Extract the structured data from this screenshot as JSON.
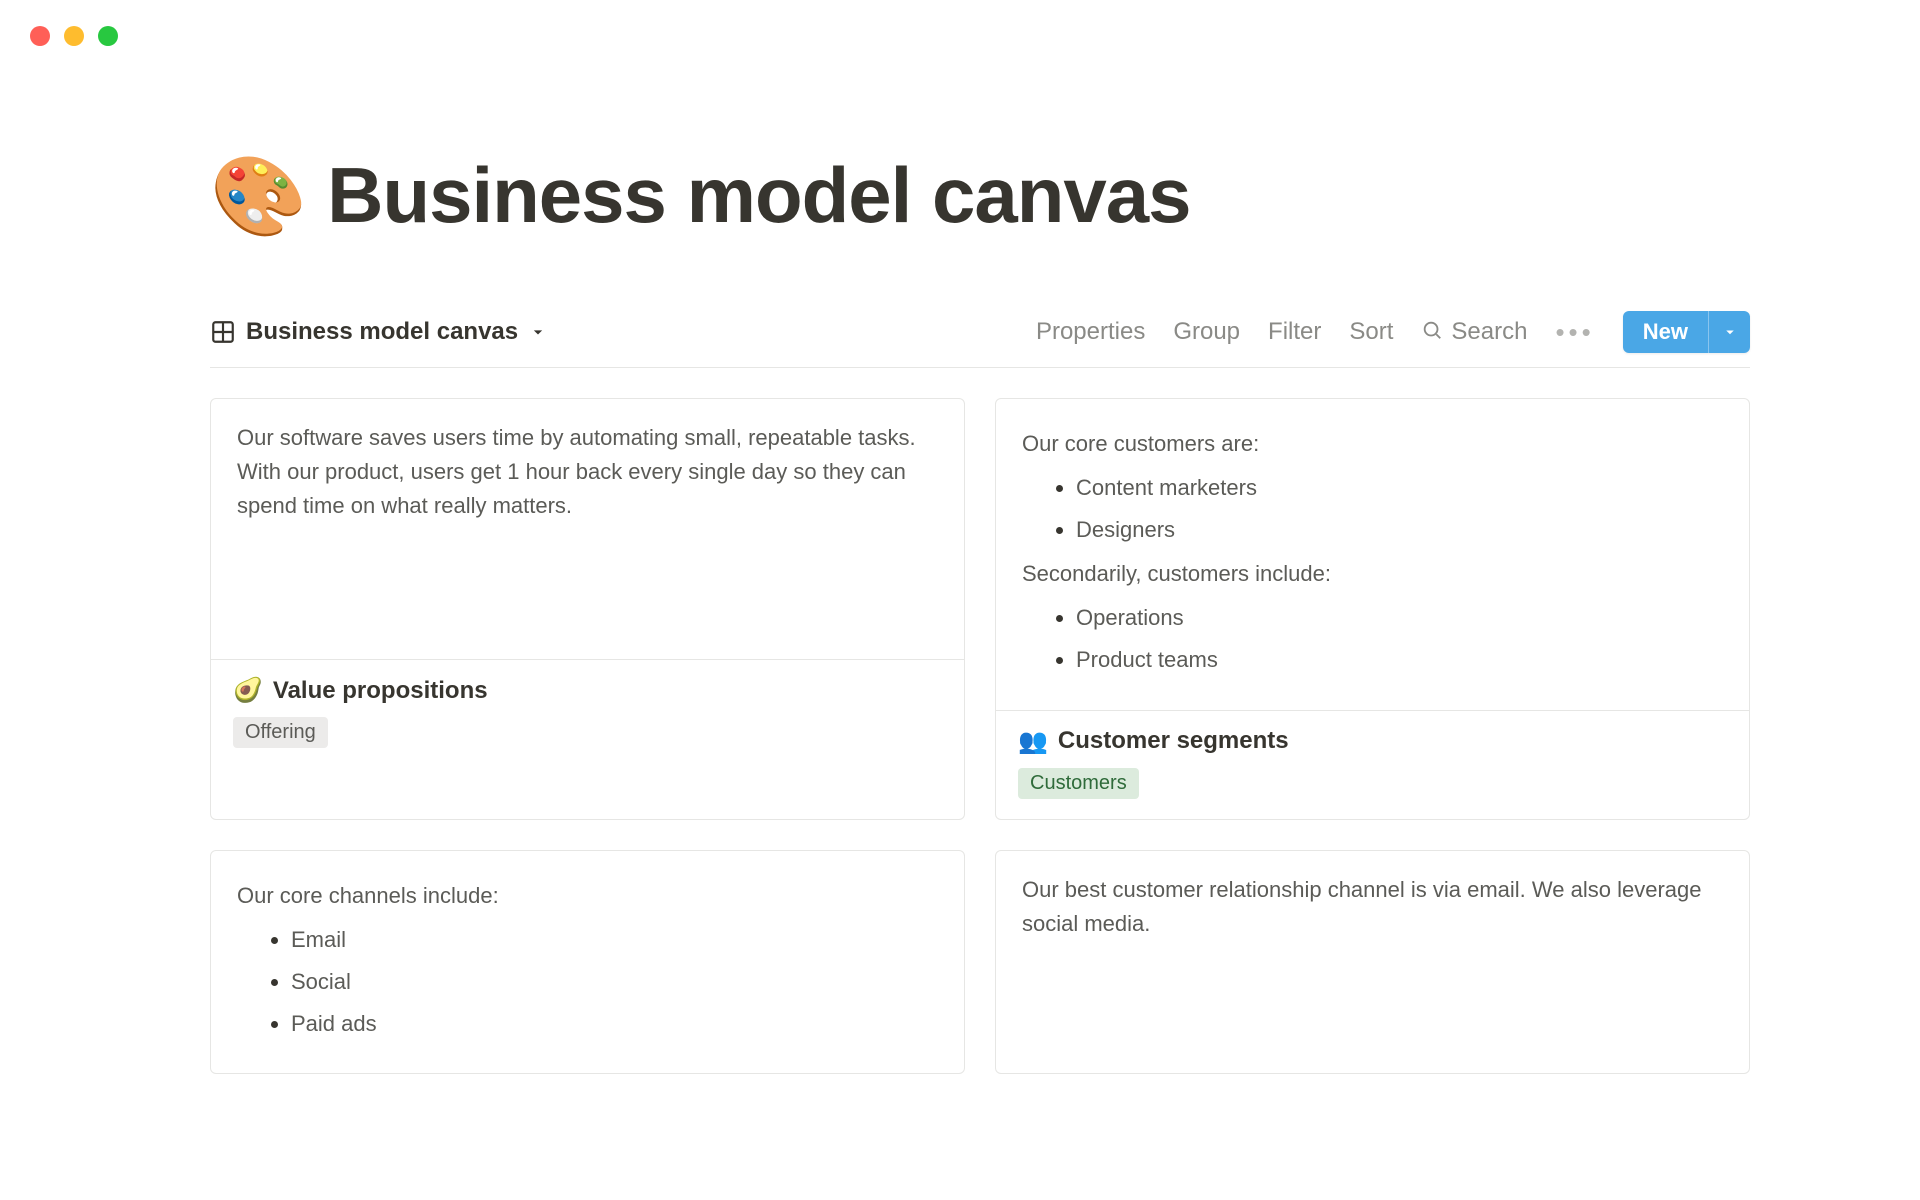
{
  "page": {
    "icon": "🎨",
    "title": "Business model canvas"
  },
  "toolbar": {
    "view_name": "Business model canvas",
    "properties": "Properties",
    "group": "Group",
    "filter": "Filter",
    "sort": "Sort",
    "search": "Search",
    "new_label": "New"
  },
  "cards": {
    "value_prop": {
      "text": "Our software saves users time by automating small, repeatable tasks. With our product, users get 1 hour back every single day so they can spend time on what really matters.",
      "icon": "🥑",
      "title": "Value propositions",
      "tag": "Offering"
    },
    "customer_segments": {
      "lead": "Our core customers are:",
      "core": [
        "Content marketers",
        "Designers"
      ],
      "secondary_lead": "Secondarily, customers include:",
      "secondary": [
        "Operations",
        "Product teams"
      ],
      "icon": "👥",
      "title": "Customer segments",
      "tag": "Customers"
    },
    "channels": {
      "lead": "Our core channels include:",
      "items": [
        "Email",
        "Social",
        "Paid ads"
      ]
    },
    "relationships": {
      "text": "Our best customer relationship channel is via email. We also leverage social media."
    }
  }
}
